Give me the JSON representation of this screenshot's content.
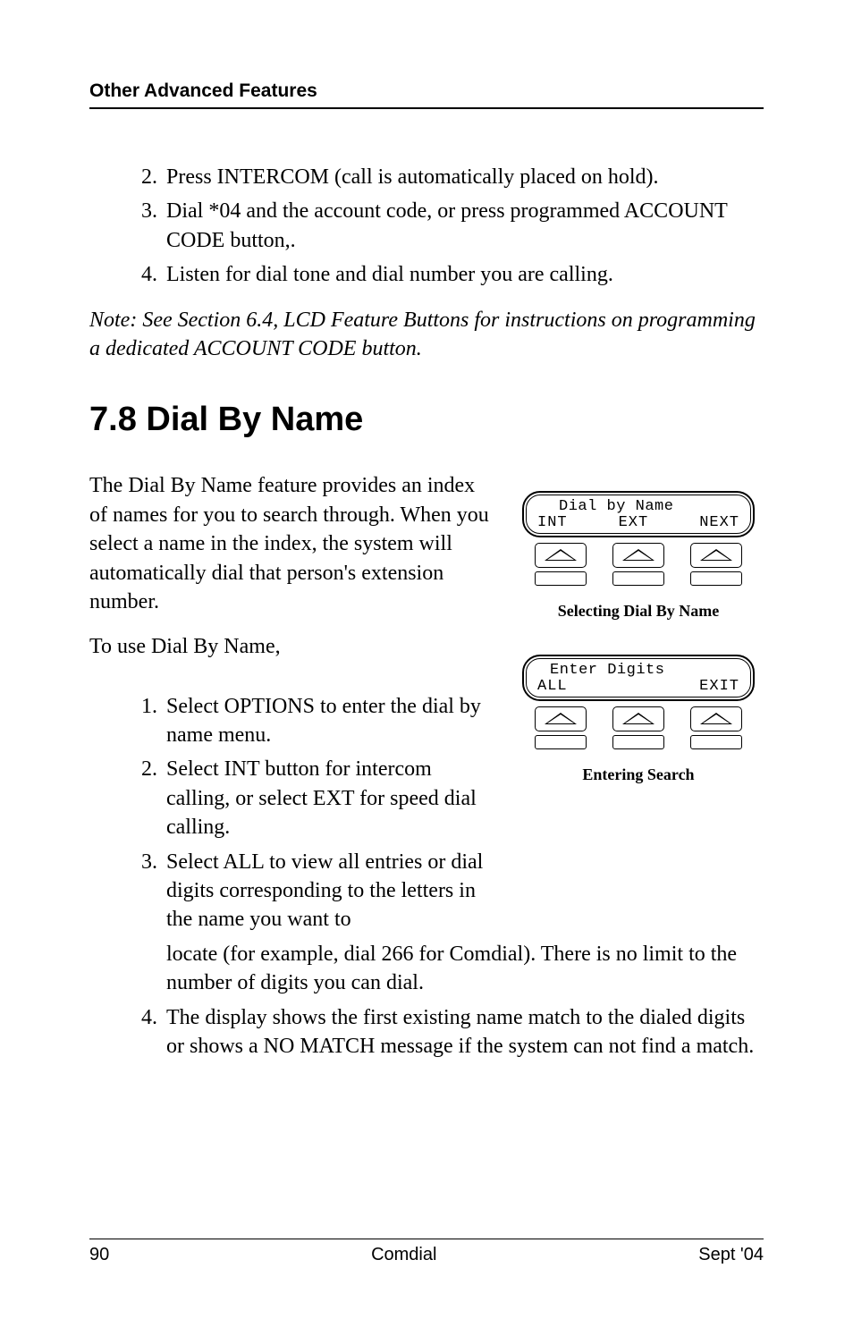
{
  "header": "Other Advanced Features",
  "top_list": [
    {
      "num": "2.",
      "text": "Press INTERCOM (call is automatically placed on hold)."
    },
    {
      "num": "3.",
      "text": "Dial *04 and the account code, or press programmed ACCOUNT CODE button,."
    },
    {
      "num": "4.",
      "text": "Listen for dial tone and dial number you are calling."
    }
  ],
  "note": "Note:  See Section 6.4, LCD Feature Buttons for instructions on programming a dedicated ACCOUNT CODE button.",
  "section_title": "7.8  Dial By Name",
  "intro": "The Dial By Name feature provides an index of names for you to search through. When you select a name in the index, the system will automatically dial that person's extension number.",
  "intro2": "To use Dial By Name,",
  "steps": [
    {
      "num": "1.",
      "text": "Select OPTIONS to enter the dial by name menu."
    },
    {
      "num": "2.",
      "text": "Select INT button for intercom calling, or select EXT for speed dial calling."
    },
    {
      "num": "3.",
      "text": "Select ALL to view all entries or dial digits corresponding to the letters in the name you want to "
    }
  ],
  "step3_cont": "locate (for example, dial 266 for Comdial).   There is no limit to the number of digits you can dial.",
  "step4": {
    "num": "4.",
    "text": "The display shows the first existing name match to the dialed digits or shows a  NO MATCH message if the system can not find a match."
  },
  "fig1": {
    "row1": "Dial by Name",
    "r2a": "INT",
    "r2b": "EXT",
    "r2c": "NEXT",
    "caption": "Selecting Dial By Name"
  },
  "fig2": {
    "row1": "Enter Digits",
    "r2a": "ALL",
    "r2b": "",
    "r2c": "EXIT",
    "caption": "Entering Search"
  },
  "footer": {
    "left": "90",
    "center": "Comdial",
    "right": "Sept '04"
  }
}
